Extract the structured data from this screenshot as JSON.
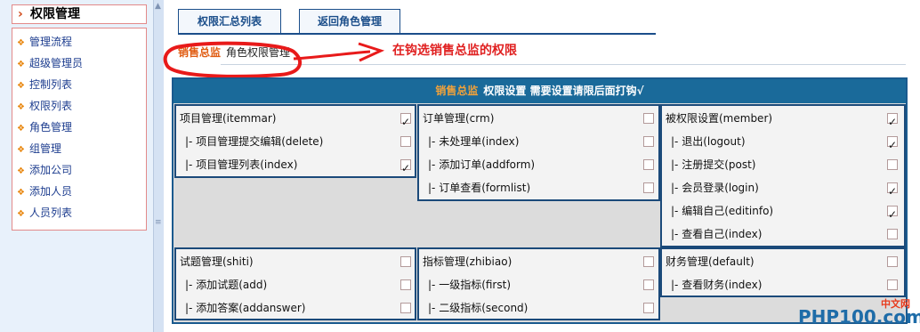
{
  "sidebar": {
    "title": "权限管理",
    "items": [
      {
        "label": "管理流程"
      },
      {
        "label": "超级管理员"
      },
      {
        "label": "控制列表"
      },
      {
        "label": "权限列表"
      },
      {
        "label": "角色管理"
      },
      {
        "label": "组管理"
      },
      {
        "label": "添加公司"
      },
      {
        "label": "添加人员"
      },
      {
        "label": "人员列表"
      }
    ]
  },
  "tabs": [
    {
      "label": "权限汇总列表"
    },
    {
      "label": "返回角色管理"
    }
  ],
  "role_bar": {
    "role_name": "销售总监",
    "tail": "角色权限管理"
  },
  "annotation": {
    "text": "在钩选销售总监的权限",
    "color": "#e02020"
  },
  "panel": {
    "header_role": "销售总监",
    "header_text": "权限设置 需要设置请限后面打钩√"
  },
  "groups": [
    {
      "rows": [
        {
          "label": "项目管理(itemmar)",
          "checked": true
        },
        {
          "label": "|- 项目管理提交编辑(delete)",
          "checked": false
        },
        {
          "label": "|- 项目管理列表(index)",
          "checked": true
        }
      ]
    },
    {
      "rows": [
        {
          "label": "订单管理(crm)",
          "checked": false
        },
        {
          "label": "|- 未处理单(index)",
          "checked": false
        },
        {
          "label": "|- 添加订单(addform)",
          "checked": false
        },
        {
          "label": "|- 订单查看(formlist)",
          "checked": false
        }
      ]
    },
    {
      "rows": [
        {
          "label": "被权限设置(member)",
          "checked": true
        },
        {
          "label": "|- 退出(logout)",
          "checked": true
        },
        {
          "label": "|- 注册提交(post)",
          "checked": false
        },
        {
          "label": "|- 会员登录(login)",
          "checked": true
        },
        {
          "label": "|- 编辑自己(editinfo)",
          "checked": true
        },
        {
          "label": "|- 查看自己(index)",
          "checked": false
        }
      ]
    },
    {
      "rows": [
        {
          "label": "试题管理(shiti)",
          "checked": false
        },
        {
          "label": "|- 添加试题(add)",
          "checked": false
        },
        {
          "label": "|- 添加答案(addanswer)",
          "checked": false
        }
      ]
    },
    {
      "rows": [
        {
          "label": "指标管理(zhibiao)",
          "checked": false
        },
        {
          "label": "|- 一级指标(first)",
          "checked": false
        },
        {
          "label": "|- 二级指标(second)",
          "checked": false
        }
      ]
    },
    {
      "rows": [
        {
          "label": "财务管理(default)",
          "checked": false
        },
        {
          "label": "|- 查看财务(index)",
          "checked": false
        }
      ]
    }
  ],
  "watermark": {
    "cn": "中文网",
    "en": "PHP100.com"
  },
  "colors": {
    "accent": "#1a5a8e",
    "role": "#e05c12",
    "annotation": "#e02020"
  }
}
